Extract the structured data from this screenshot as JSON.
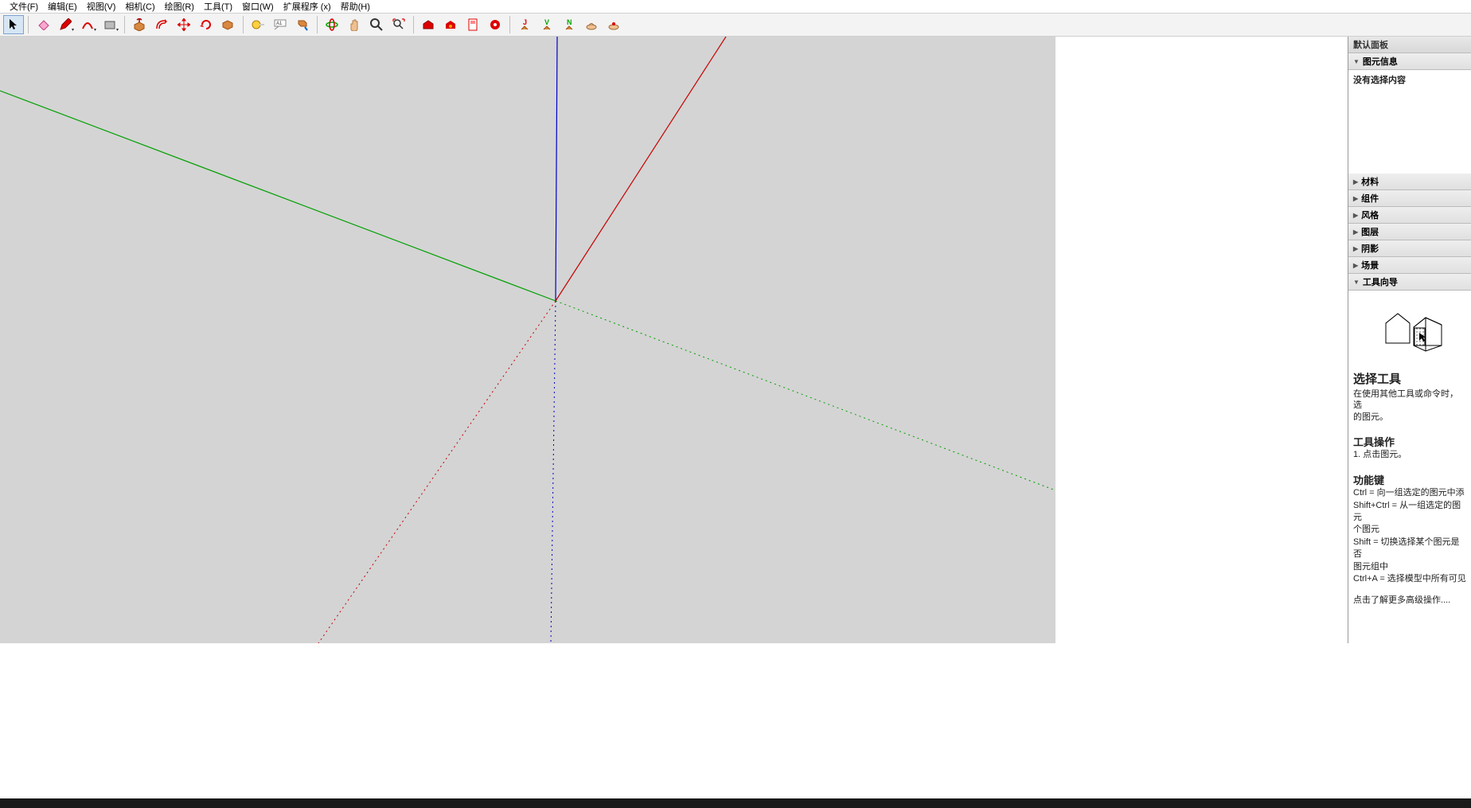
{
  "menu": {
    "file": "文件(F)",
    "edit": "编辑(E)",
    "view": "视图(V)",
    "camera": "相机(C)",
    "draw": "绘图(R)",
    "tools": "工具(T)",
    "window": "窗口(W)",
    "extensions": "扩展程序 (x)",
    "help": "帮助(H)"
  },
  "panel": {
    "title": "默认面板",
    "entity_info": "图元信息",
    "entity_info_empty": "没有选择内容",
    "materials": "材料",
    "components": "组件",
    "styles": "风格",
    "layers": "图层",
    "shadows": "阴影",
    "scenes": "场景",
    "instructor": "工具向导"
  },
  "instructor": {
    "title": "选择工具",
    "desc": "在使用其他工具或命令时，选\n的图元。",
    "ops_title": "工具操作",
    "op1": "1. 点击图元。",
    "keys_title": "功能键",
    "key1": "Ctrl = 向一组选定的图元中添",
    "key2": "Shift+Ctrl = 从一组选定的图元\n个图元",
    "key3": "Shift = 切换选择某个图元是否\n图元组中",
    "key4": "Ctrl+A = 选择模型中所有可见",
    "more": "点击了解更多高级操作...."
  }
}
